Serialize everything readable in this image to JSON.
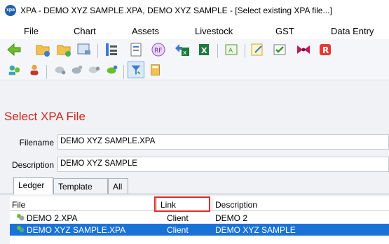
{
  "window": {
    "logo_text": "xpa",
    "title": "XPA - DEMO XYZ SAMPLE.XPA, DEMO XYZ SAMPLE - [Select existing XPA file...]"
  },
  "menu": [
    {
      "label": "File"
    },
    {
      "label": "Chart"
    },
    {
      "label": "Assets"
    },
    {
      "label": "Livestock"
    },
    {
      "label": "GST"
    },
    {
      "label": "Data Entry"
    }
  ],
  "toolbar_icons": [
    "back-arrow-icon",
    "open-folder-icon",
    "folder-icon",
    "print-preview-icon",
    "chart-of-accounts-icon",
    "document-icon",
    "rf-icon",
    "excel-export-icon",
    "excel-icon",
    "ledger-icon",
    "notepad-icon",
    "checklist-icon",
    "bowtie-icon",
    "r-icon"
  ],
  "toolbar2_icons": [
    "users-icon",
    "person-icon",
    "livestock-icon",
    "cattle-icon",
    "sheep-icon",
    "goats-icon",
    "filter-icon",
    "calculator-icon"
  ],
  "select_panel": {
    "heading": "Select XPA File",
    "filename_label": "Filename",
    "filename_value": "DEMO XYZ SAMPLE.XPA",
    "description_label": "Description",
    "description_value": "DEMO XYZ SAMPLE"
  },
  "tabs": [
    {
      "label": "Ledger",
      "active": true
    },
    {
      "label": "Template"
    },
    {
      "label": "All"
    }
  ],
  "table": {
    "columns": [
      "File",
      "Link",
      "Description"
    ],
    "rows": [
      {
        "file": "DEMO 2.XPA",
        "link": "Client",
        "description": "DEMO 2",
        "selected": false
      },
      {
        "file": "DEMO XYZ SAMPLE.XPA",
        "link": "Client",
        "description": "DEMO XYZ SAMPLE",
        "selected": true
      }
    ]
  },
  "colors": {
    "heading": "#d0271d",
    "selection": "#1b72d6",
    "highlight_box": "#e02b2b"
  }
}
